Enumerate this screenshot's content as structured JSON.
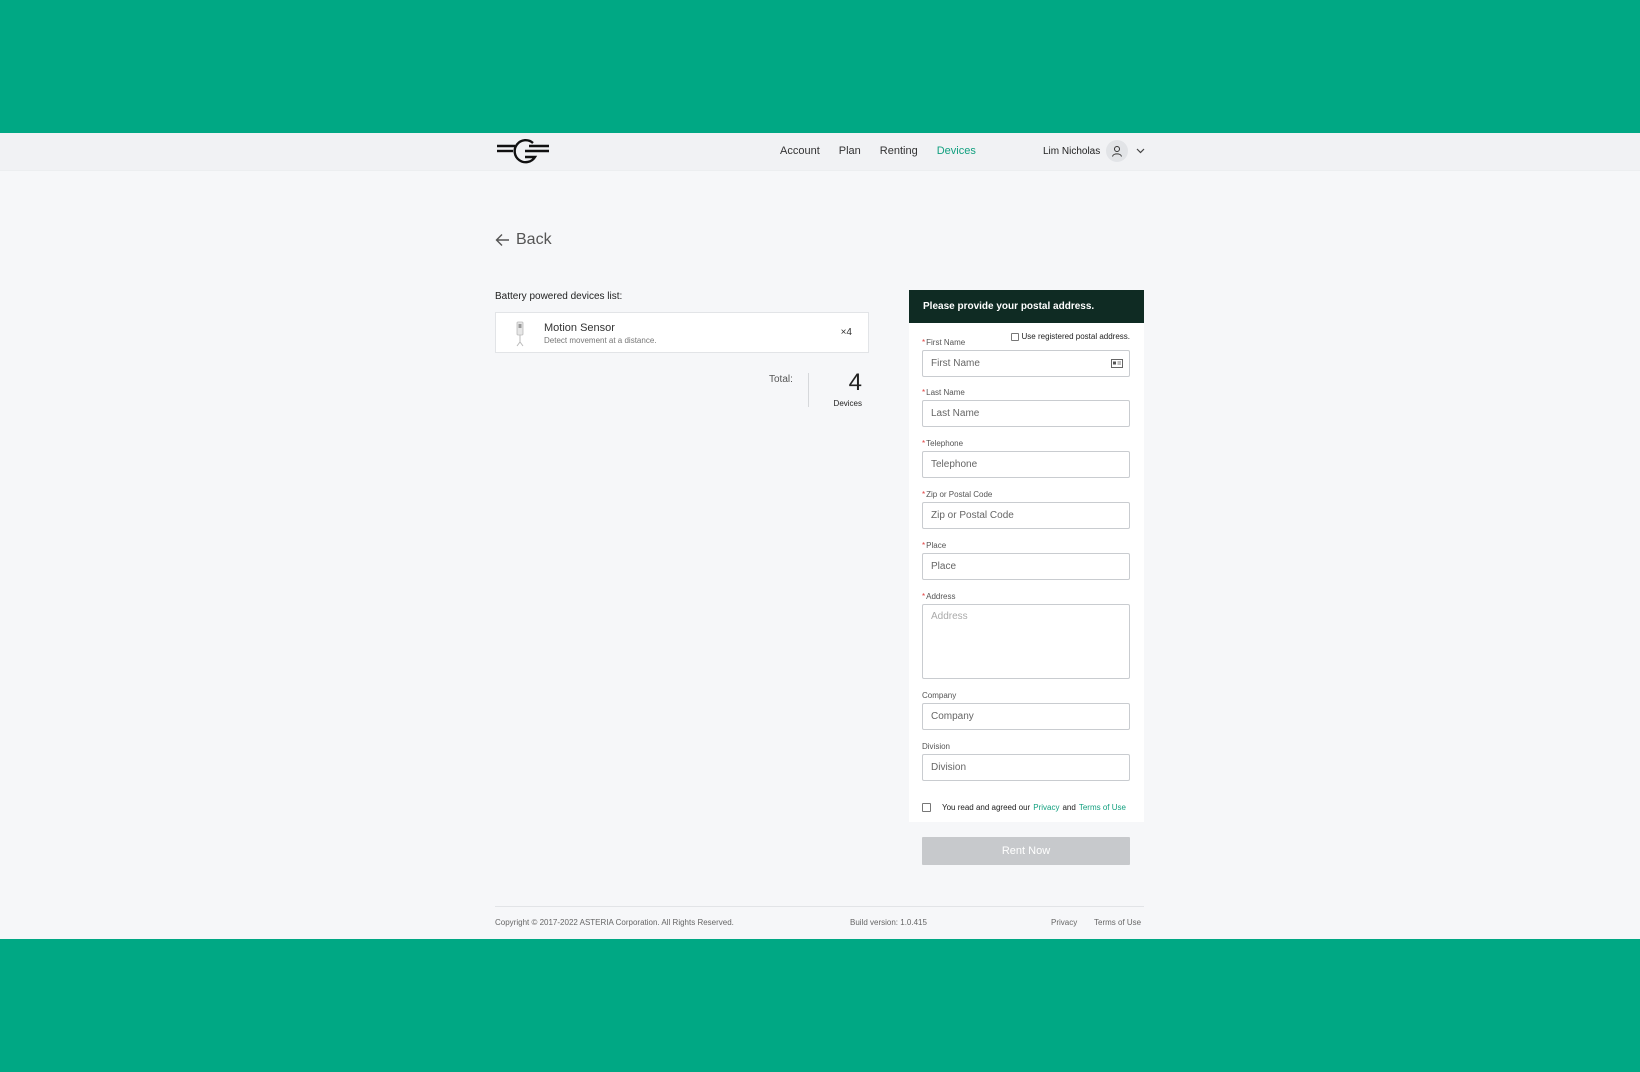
{
  "nav": {
    "items": [
      {
        "label": "Account"
      },
      {
        "label": "Plan"
      },
      {
        "label": "Renting"
      },
      {
        "label": "Devices"
      }
    ],
    "active": "Devices",
    "user_name": "Lim Nicholas"
  },
  "back_label": "Back",
  "devices": {
    "list_title": "Battery powered devices list:",
    "items": [
      {
        "name": "Motion Sensor",
        "description": "Detect movement at a distance.",
        "quantity": "×4"
      }
    ],
    "total_label": "Total:",
    "total_count": "4",
    "total_unit": "Devices"
  },
  "form": {
    "header": "Please provide your postal address.",
    "use_registered_label": "Use registered postal address.",
    "required_mark": "*",
    "first_name": {
      "label": "First Name",
      "placeholder": "First Name"
    },
    "last_name": {
      "label": "Last Name",
      "placeholder": "Last Name"
    },
    "telephone": {
      "label": "Telephone",
      "placeholder": "Telephone"
    },
    "zip": {
      "label": "Zip or Postal Code",
      "placeholder": "Zip or Postal Code"
    },
    "place": {
      "label": "Place",
      "placeholder": "Place"
    },
    "address": {
      "label": "Address",
      "placeholder": "Address"
    },
    "company": {
      "label": "Company",
      "placeholder": "Company"
    },
    "division": {
      "label": "Division",
      "placeholder": "Division"
    },
    "agree_prefix": "You read and agreed our",
    "agree_privacy": "Privacy",
    "agree_and": "and",
    "agree_terms": "Terms of Use",
    "submit_label": "Rent Now"
  },
  "footer": {
    "copyright": "Copyright © 2017-2022 ASTERIA Corporation. All Rights Reserved.",
    "build": "Build version: 1.0.415",
    "privacy": "Privacy",
    "terms": "Terms of Use"
  },
  "colors": {
    "accent": "#12a07f",
    "backdrop": "#00a884",
    "header_dark": "#0f2b23",
    "button_disabled": "#c7c9cc"
  }
}
